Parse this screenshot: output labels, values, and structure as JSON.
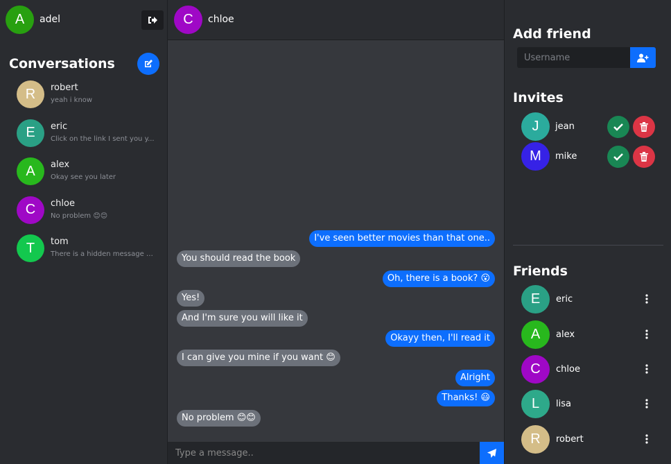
{
  "colors": {
    "primary": "#0d6efd",
    "success": "#198754",
    "danger": "#dc3545",
    "incoming_bubble": "#6c717a"
  },
  "user": {
    "name": "adel",
    "initial": "A",
    "color": "#28a010"
  },
  "icons": {
    "logout": "sign-out-icon",
    "compose": "edit-icon",
    "send": "paper-plane-icon",
    "add_friend": "user-plus-icon",
    "accept": "check-icon",
    "decline": "trash-icon",
    "more": "ellipsis-vertical-icon"
  },
  "conversations": {
    "title": "Conversations",
    "items": [
      {
        "initial": "R",
        "name": "robert",
        "preview": "yeah i know",
        "color": "#d4bd88"
      },
      {
        "initial": "E",
        "name": "eric",
        "preview": "Click on the link I sent you y...",
        "color": "#2aa085"
      },
      {
        "initial": "A",
        "name": "alex",
        "preview": "Okay see you later",
        "color": "#28b81d"
      },
      {
        "initial": "C",
        "name": "chloe",
        "preview": "No problem 😊😊",
        "color": "#9f08c6"
      },
      {
        "initial": "T",
        "name": "tom",
        "preview": "There is a hidden message here",
        "color": "#13c84e"
      }
    ]
  },
  "chat": {
    "contact": {
      "name": "chloe",
      "initial": "C",
      "color": "#9f08c6"
    },
    "messages": [
      {
        "dir": "out",
        "text": "I've seen better movies than that one.."
      },
      {
        "dir": "in",
        "text": "You should read the book"
      },
      {
        "dir": "out",
        "text": "Oh, there is a book? 😮"
      },
      {
        "dir": "in",
        "text": "Yes!"
      },
      {
        "dir": "in",
        "text": "And I'm sure you will like it"
      },
      {
        "dir": "out",
        "text": "Okayy then, I'll read it"
      },
      {
        "dir": "in",
        "text": "I can give you mine if you want 😊"
      },
      {
        "dir": "out",
        "text": "Alright"
      },
      {
        "dir": "out",
        "text": "Thanks! 😃"
      },
      {
        "dir": "in",
        "text": "No problem 😊😊"
      }
    ],
    "input_placeholder": "Type a message.."
  },
  "add_friend": {
    "title": "Add friend",
    "placeholder": "Username"
  },
  "invites": {
    "title": "Invites",
    "items": [
      {
        "initial": "J",
        "name": "jean",
        "color": "#2bab9d"
      },
      {
        "initial": "M",
        "name": "mike",
        "color": "#3622e6"
      }
    ]
  },
  "friends": {
    "title": "Friends",
    "items": [
      {
        "initial": "E",
        "name": "eric",
        "color": "#2aa085"
      },
      {
        "initial": "A",
        "name": "alex",
        "color": "#28b81d"
      },
      {
        "initial": "C",
        "name": "chloe",
        "color": "#9f08c6"
      },
      {
        "initial": "L",
        "name": "lisa",
        "color": "#2ea98a"
      },
      {
        "initial": "R",
        "name": "robert",
        "color": "#d4bd88"
      }
    ]
  }
}
